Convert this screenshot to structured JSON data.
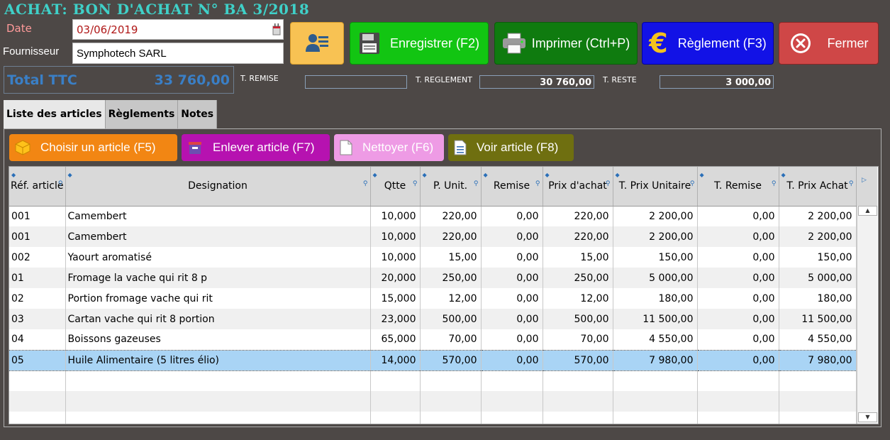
{
  "window": {
    "title": "ACHAT: BON D'ACHAT N° BA 3/2018"
  },
  "header": {
    "date_label": "Date",
    "date_value": "03/06/2019",
    "supplier_label": "Fournisseur",
    "supplier_value": "Symphotech SARL"
  },
  "buttons": {
    "save": "Enregistrer (F2)",
    "print": "Imprimer (Ctrl+P)",
    "payment": "Règlement (F3)",
    "close": "Fermer"
  },
  "totals": {
    "total_ttc_label": "Total TTC",
    "total_ttc_value": "33 760,00",
    "remise_label": "T. REMISE",
    "remise_value": "",
    "reglement_label": "T. REGLEMENT",
    "reglement_value": "30 760,00",
    "reste_label": "T. RESTE",
    "reste_value": "3 000,00"
  },
  "tabs": [
    {
      "label": "Liste des articles",
      "active": true
    },
    {
      "label": "Règlements"
    },
    {
      "label": "Notes"
    }
  ],
  "toolbar": {
    "choose": "Choisir un article (F5)",
    "remove": "Enlever article (F7)",
    "clear": "Nettoyer (F6)",
    "view": "Voir article (F8)"
  },
  "table": {
    "columns": [
      "Réf. article",
      "Designation",
      "Qtte",
      "P. Unit.",
      "Remise",
      "Prix d'achat",
      "T. Prix Unitaire",
      "T.  Remise",
      "T. Prix Achat"
    ],
    "rows": [
      [
        "001",
        "Camembert",
        "10,000",
        "220,00",
        "0,00",
        "220,00",
        "2 200,00",
        "0,00",
        "2 200,00"
      ],
      [
        "001",
        "Camembert",
        "10,000",
        "220,00",
        "0,00",
        "220,00",
        "2 200,00",
        "0,00",
        "2 200,00"
      ],
      [
        "002",
        "Yaourt aromatisé",
        "10,000",
        "15,00",
        "0,00",
        "15,00",
        "150,00",
        "0,00",
        "150,00"
      ],
      [
        "01",
        "Fromage la vache qui rit 8 p",
        "20,000",
        "250,00",
        "0,00",
        "250,00",
        "5 000,00",
        "0,00",
        "5 000,00"
      ],
      [
        "02",
        "Portion fromage vache qui rit",
        "15,000",
        "12,00",
        "0,00",
        "12,00",
        "180,00",
        "0,00",
        "180,00"
      ],
      [
        "03",
        "Cartan vache qui rit 8 portion",
        "23,000",
        "500,00",
        "0,00",
        "500,00",
        "11 500,00",
        "0,00",
        "11 500,00"
      ],
      [
        "04",
        "Boissons gazeuses",
        "65,000",
        "70,00",
        "0,00",
        "70,00",
        "4 550,00",
        "0,00",
        "4 550,00"
      ],
      [
        "05",
        "Huile Alimentaire (5 litres élio)",
        "14,000",
        "570,00",
        "0,00",
        "570,00",
        "7 980,00",
        "0,00",
        "7 980,00"
      ]
    ],
    "selected_row": 7
  },
  "colors": {
    "title": "#3fd0c8",
    "save": "#12c512",
    "print": "#0f7b0f",
    "payment": "#1212e6",
    "close": "#cf4747",
    "selected_row": "#a9d4f5"
  }
}
